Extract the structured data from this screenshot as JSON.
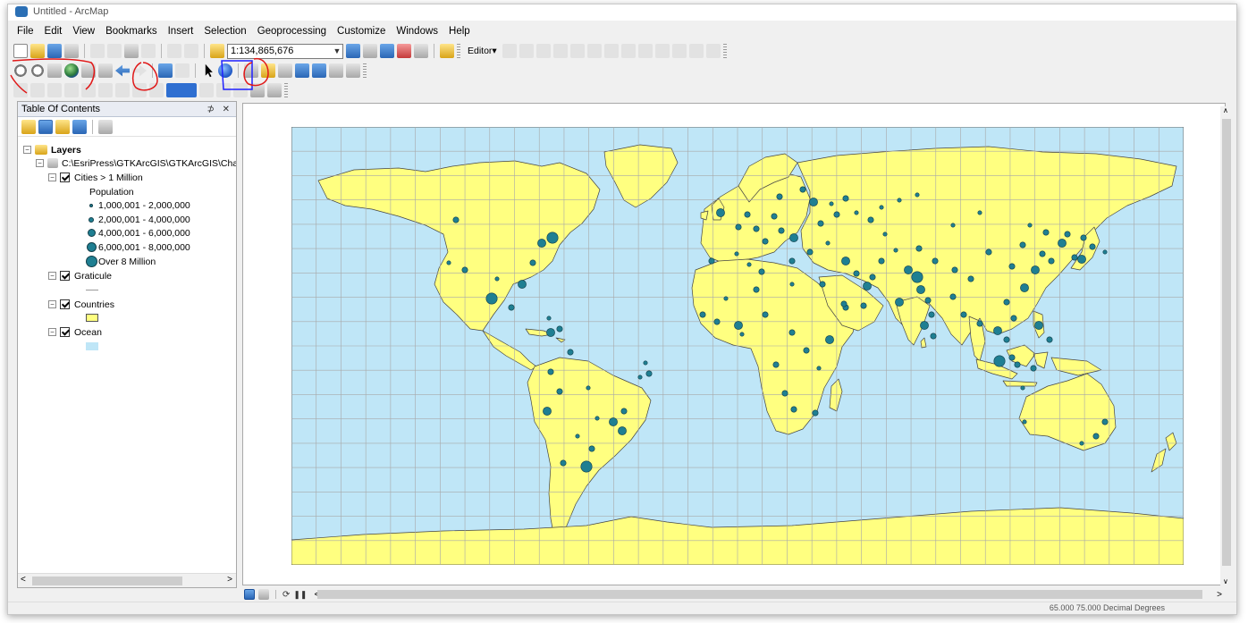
{
  "window": {
    "title": "Untitled - ArcMap"
  },
  "menu": [
    "File",
    "Edit",
    "View",
    "Bookmarks",
    "Insert",
    "Selection",
    "Geoprocessing",
    "Customize",
    "Windows",
    "Help"
  ],
  "toolbar": {
    "scale_value": "1:134,865,676",
    "editor_label": "Editor▾"
  },
  "toc": {
    "title": "Table Of Contents",
    "controls": "⊅ ✕",
    "tree": {
      "root_label": "Layers",
      "path_label": "C:\\EsriPress\\GTKArcGIS\\GTKArcGIS\\Cha",
      "layers": [
        {
          "name": "Cities > 1 Million",
          "legend_title": "Population",
          "classes": [
            "1,000,001 - 2,000,000",
            "2,000,001 - 4,000,000",
            "4,000,001 - 6,000,000",
            "6,000,001 - 8,000,000",
            "Over 8 Million"
          ]
        },
        {
          "name": "Graticule"
        },
        {
          "name": "Countries"
        },
        {
          "name": "Ocean"
        }
      ]
    }
  },
  "colors": {
    "ocean": "#bfe6f7",
    "land": "#ffff80",
    "city": "#1f7f92",
    "border": "#444444",
    "graticule": "#a8a8a8"
  },
  "status": {
    "coords": "65.000  75.000 Decimal Degrees"
  }
}
